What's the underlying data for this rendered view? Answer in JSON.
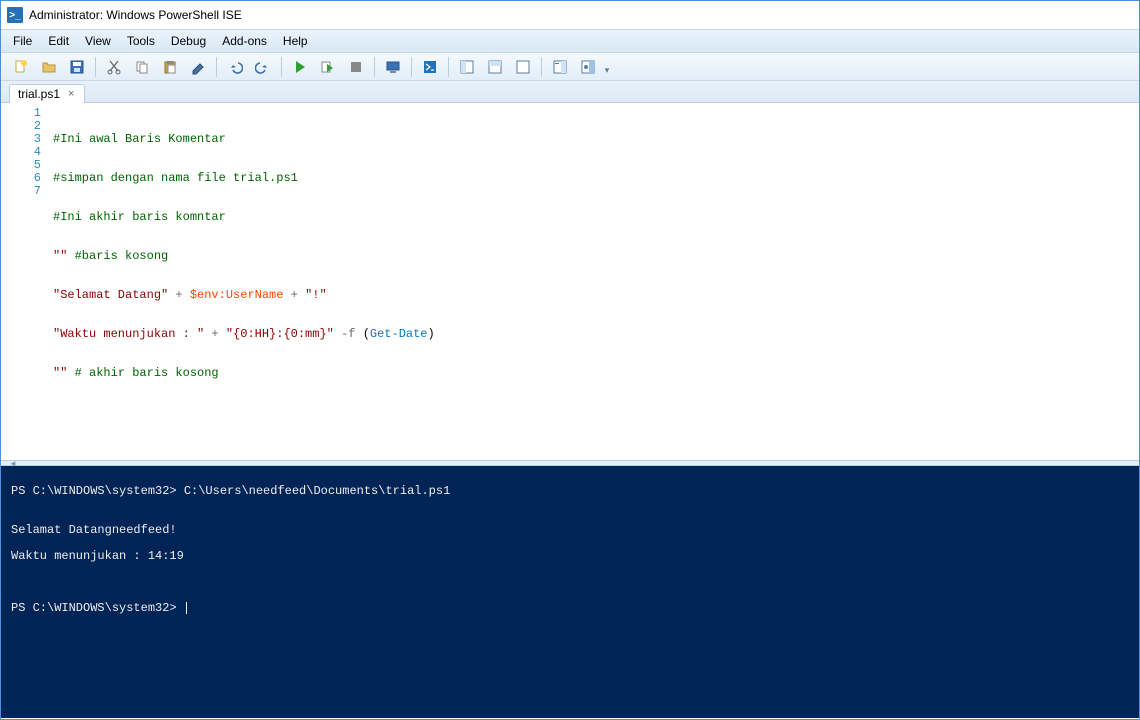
{
  "window": {
    "title": "Administrator: Windows PowerShell ISE",
    "app_icon_text": ">_"
  },
  "menu": {
    "file": "File",
    "edit": "Edit",
    "view": "View",
    "tools": "Tools",
    "debug": "Debug",
    "addons": "Add-ons",
    "help": "Help"
  },
  "toolbar_icons": {
    "new": "new-file-icon",
    "open": "open-folder-icon",
    "save": "save-icon",
    "cut": "cut-icon",
    "copy": "copy-icon",
    "paste": "paste-icon",
    "clear": "clear-icon",
    "undo": "undo-icon",
    "redo": "redo-icon",
    "run": "run-icon",
    "run_selection": "run-selection-icon",
    "stop": "stop-icon",
    "remote": "remote-icon",
    "powershell": "powershell-icon",
    "layout1": "layout-side-icon",
    "layout2": "layout-split-icon",
    "layout3": "layout-single-icon",
    "cmdpane": "command-pane-icon",
    "cmdaddon": "command-addon-icon"
  },
  "tab": {
    "name": "trial.ps1",
    "close": "×"
  },
  "editor": {
    "line_numbers": [
      "1",
      "2",
      "3",
      "4",
      "5",
      "6",
      "7"
    ],
    "lines": {
      "l1_comment": "#Ini awal Baris Komentar",
      "l2_comment": "#simpan dengan nama file trial.ps1",
      "l3_comment": "#Ini akhir baris komntar",
      "l4_q": "\"\"",
      "l4_comment": " #baris kosong",
      "l5_s1": "\"Selamat Datang\"",
      "l5_plus1": " + ",
      "l5_var": "$env:UserName",
      "l5_plus2": " + ",
      "l5_s2": "\"!\"",
      "l6_s1": "\"Waktu menunjukan : \"",
      "l6_plus1": " + ",
      "l6_s2": "\"{0:HH}:{0:mm}\"",
      "l6_op": " -f ",
      "l6_paren_o": "(",
      "l6_cmd": "Get-Date",
      "l6_paren_c": ")",
      "l7_q": "\"\"",
      "l7_comment": " # akhir baris kosong"
    }
  },
  "console": {
    "line1": "PS C:\\WINDOWS\\system32> C:\\Users\\needfeed\\Documents\\trial.ps1",
    "blank1": "",
    "line2": "Selamat Datangneedfeed!",
    "line3": "Waktu menunjukan : 14:19",
    "blank2": "",
    "blank3": "",
    "prompt": "PS C:\\WINDOWS\\system32> "
  }
}
